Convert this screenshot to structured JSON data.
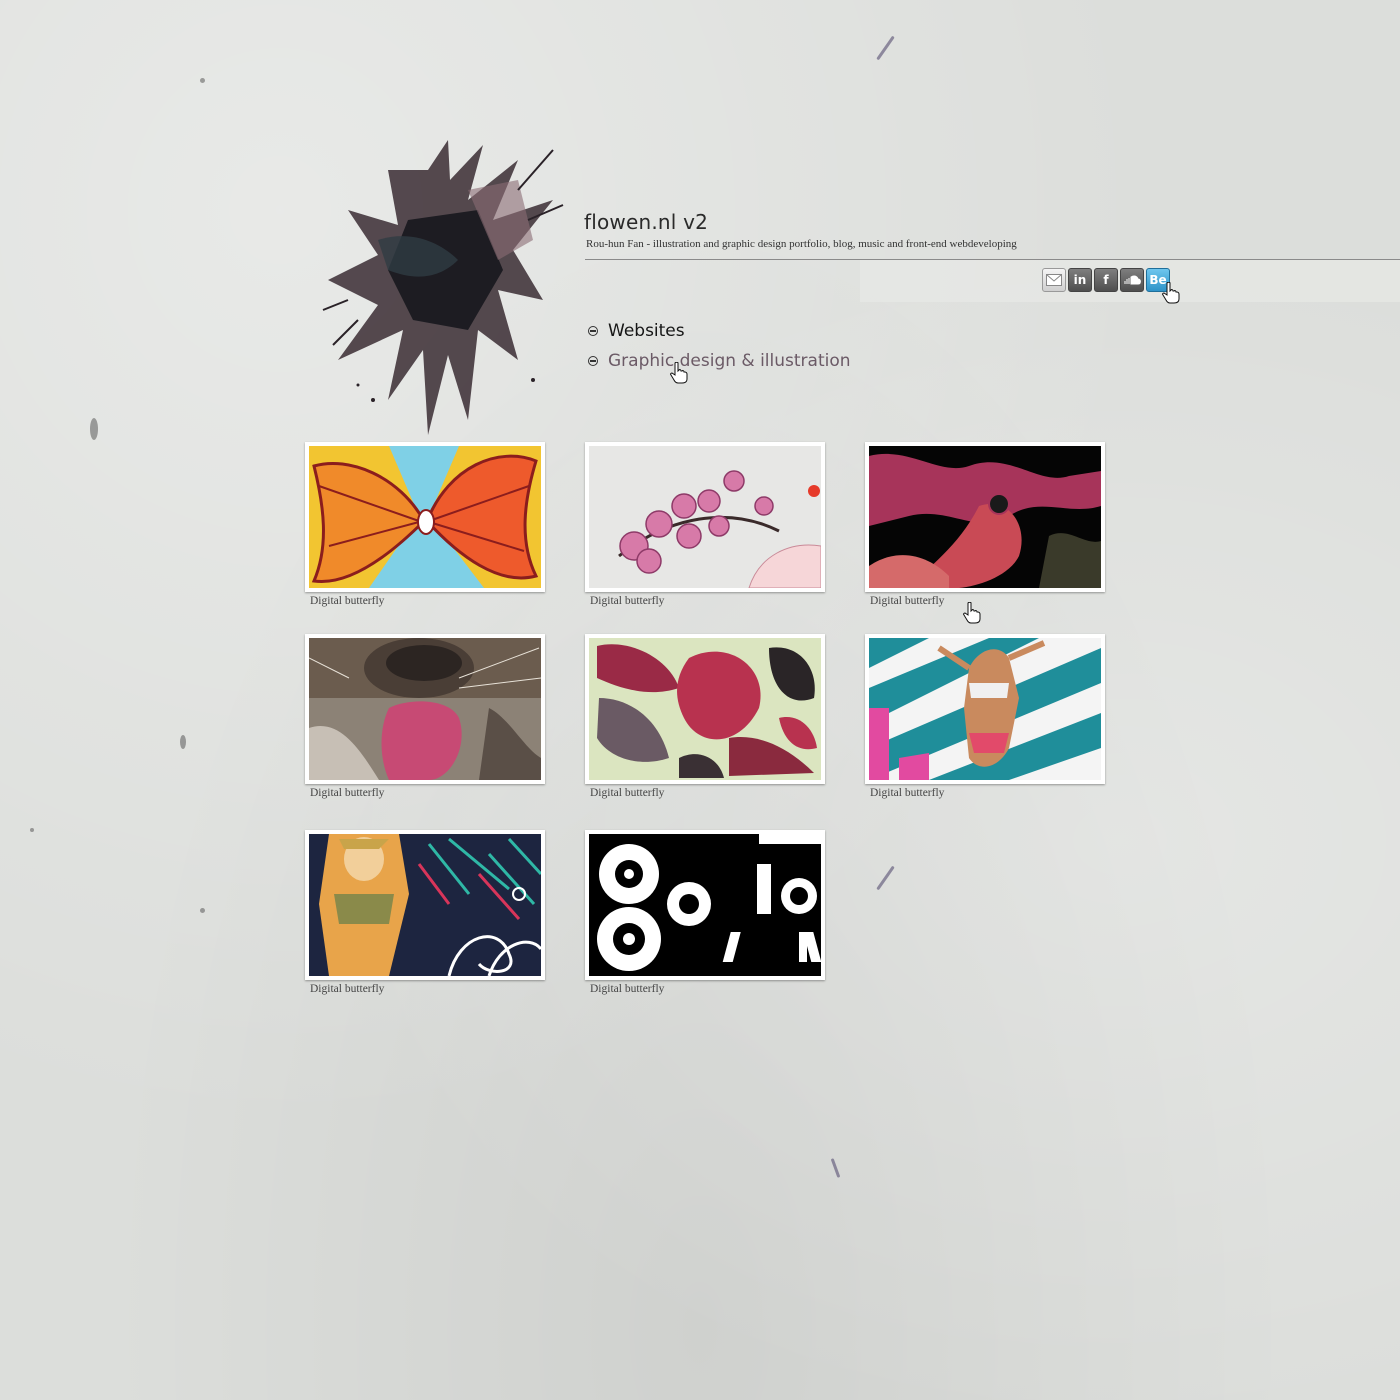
{
  "header": {
    "title": "flowen.nl v2",
    "subtitle": "Rou-hun Fan - illustration and graphic design portfolio, blog, music and front-end webdeveloping"
  },
  "social": [
    {
      "name": "mail-icon",
      "label": ""
    },
    {
      "name": "linkedin-icon",
      "label": "in"
    },
    {
      "name": "facebook-icon",
      "label": "f"
    },
    {
      "name": "soundcloud-icon",
      "label": ""
    },
    {
      "name": "behance-icon",
      "label": "Be"
    }
  ],
  "nav": {
    "items": [
      {
        "label": "Websites",
        "active": false
      },
      {
        "label": "Graphic design & illustration",
        "active": true
      }
    ]
  },
  "gallery": {
    "items": [
      {
        "caption": "Digital butterfly",
        "art": "orange-butterfly"
      },
      {
        "caption": "Digital butterfly",
        "art": "pink-orchids"
      },
      {
        "caption": "Digital butterfly",
        "art": "dark-red-figure"
      },
      {
        "caption": "Digital butterfly",
        "art": "dog-closeup"
      },
      {
        "caption": "Digital butterfly",
        "art": "red-flower-pattern"
      },
      {
        "caption": "Digital butterfly",
        "art": "dancer-stripes"
      },
      {
        "caption": "Digital butterfly",
        "art": "girl-swirls"
      },
      {
        "caption": "Digital butterfly",
        "art": "speakers-typography"
      }
    ]
  },
  "colors": {
    "background": "#dcdedb",
    "nav_active": "#6b5a66",
    "behance": "#2e93c8"
  }
}
